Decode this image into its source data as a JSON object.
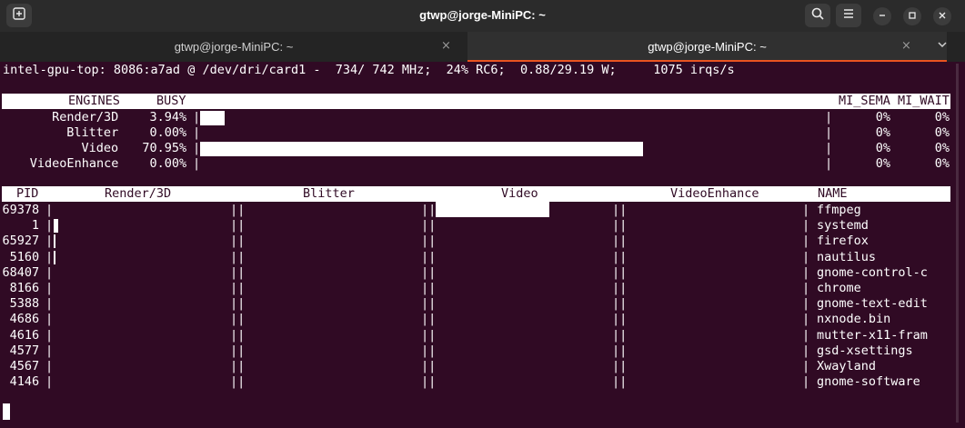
{
  "window": {
    "title": "gtwp@jorge-MiniPC: ~"
  },
  "icons": {
    "new_tab": "new-tab-icon",
    "search": "search-icon",
    "menu": "hamburger-menu-icon",
    "minimize": "minimize-icon",
    "maximize": "maximize-icon",
    "close": "close-icon",
    "tab_close": "tab-close-icon",
    "tabs_dropdown": "chevron-down-icon"
  },
  "tabs": [
    {
      "label": "gtwp@jorge-MiniPC: ~",
      "close": "×",
      "active": false
    },
    {
      "label": "gtwp@jorge-MiniPC: ~",
      "close": "×",
      "active": true
    }
  ],
  "colors": {
    "terminal_bg": "#300a24",
    "accent": "#e95420",
    "text": "#ffffff"
  },
  "gpu_top": {
    "summary": "intel-gpu-top: 8086:a7ad @ /dev/dri/card1 -  734/ 742 MHz;  24% RC6;  0.88/29.19 W;     1075 irqs/s",
    "engines_header": {
      "engines": "ENGINES",
      "busy": "BUSY",
      "sema": "MI_SEMA",
      "wait": "MI_WAIT"
    },
    "engines": [
      {
        "name": "Render/3D",
        "busy": "3.94%",
        "busy_value": 3.94,
        "sema": "0%",
        "wait": "0%"
      },
      {
        "name": "Blitter",
        "busy": "0.00%",
        "busy_value": 0.0,
        "sema": "0%",
        "wait": "0%"
      },
      {
        "name": "Video",
        "busy": "70.95%",
        "busy_value": 70.95,
        "sema": "0%",
        "wait": "0%"
      },
      {
        "name": "VideoEnhance",
        "busy": "0.00%",
        "busy_value": 0.0,
        "sema": "0%",
        "wait": "0%"
      }
    ],
    "clients_header": {
      "pid": "PID",
      "render": "Render/3D",
      "blitter": "Blitter",
      "video": "Video",
      "enhance": "VideoEnhance",
      "name": "NAME"
    },
    "clients": [
      {
        "pid": "69378",
        "name": "ffmpeg",
        "render": 0.0,
        "video": 64.0
      },
      {
        "pid": "1",
        "name": "systemd",
        "render": 2.5,
        "video": 0.0
      },
      {
        "pid": "65927",
        "name": "firefox",
        "render": 0.5,
        "video": 0.0
      },
      {
        "pid": "5160",
        "name": "nautilus",
        "render": 0.5,
        "video": 0.0
      },
      {
        "pid": "68407",
        "name": "gnome-control-c",
        "render": 0.0,
        "video": 0.0
      },
      {
        "pid": "8166",
        "name": "chrome",
        "render": 0.0,
        "video": 0.0
      },
      {
        "pid": "5388",
        "name": "gnome-text-edit",
        "render": 0.0,
        "video": 0.0
      },
      {
        "pid": "4686",
        "name": "nxnode.bin",
        "render": 0.0,
        "video": 0.0
      },
      {
        "pid": "4616",
        "name": "mutter-x11-fram",
        "render": 0.0,
        "video": 0.0
      },
      {
        "pid": "4577",
        "name": "gsd-xsettings",
        "render": 0.0,
        "video": 0.0
      },
      {
        "pid": "4567",
        "name": "Xwayland",
        "render": 0.0,
        "video": 0.0
      },
      {
        "pid": "4146",
        "name": "gnome-software",
        "render": 0.0,
        "video": 0.0
      }
    ],
    "separator": "|",
    "double_separator": "||"
  }
}
